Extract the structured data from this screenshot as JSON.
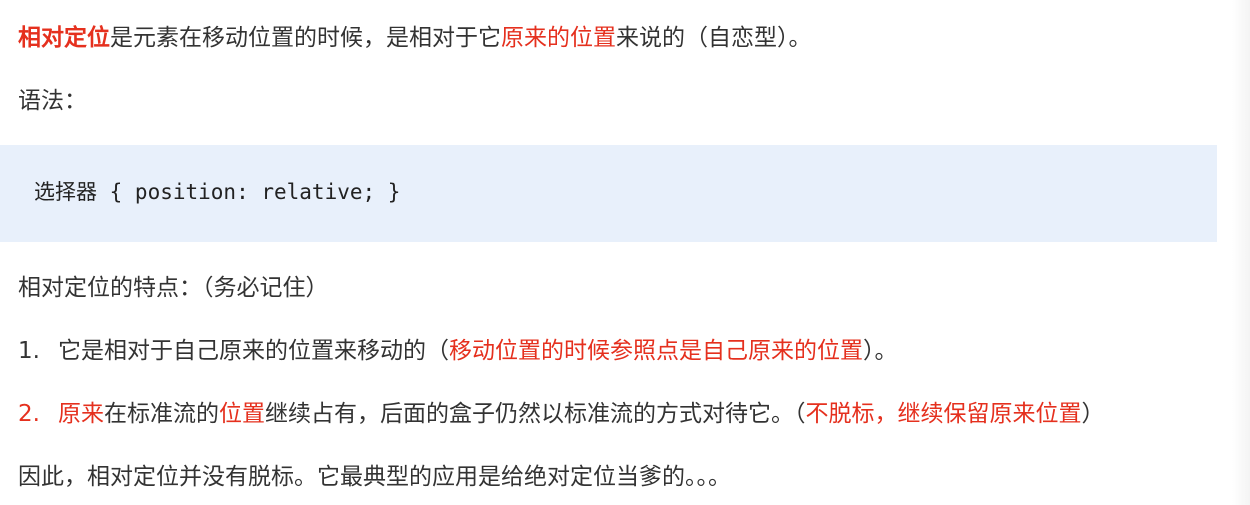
{
  "intro": {
    "term": "相对定位",
    "text1": "是元素在移动位置的时候，是相对于它",
    "highlight": "原来的位置",
    "text2": "来说的（自恋型）。"
  },
  "syntax_label": "语法：",
  "code": "选择器 { position: relative; }",
  "features_heading": "相对定位的特点：（务必记住）",
  "point1": {
    "number": "1.",
    "text": "它是相对于自己原来的位置来移动的（",
    "highlight": "移动位置的时候参照点是自己原来的位置",
    "end": "）。"
  },
  "point2": {
    "number": "2.",
    "highlight1": "原来",
    "text1": "在标准流的",
    "highlight2": "位置",
    "text2": "继续占有，后面的盒子仍然以标准流的方式对待它。（",
    "highlight3": "不脱标，继续保留原来位置",
    "end": "）"
  },
  "conclusion": "因此，相对定位并没有脱标。它最典型的应用是给绝对定位当爹的。。。"
}
